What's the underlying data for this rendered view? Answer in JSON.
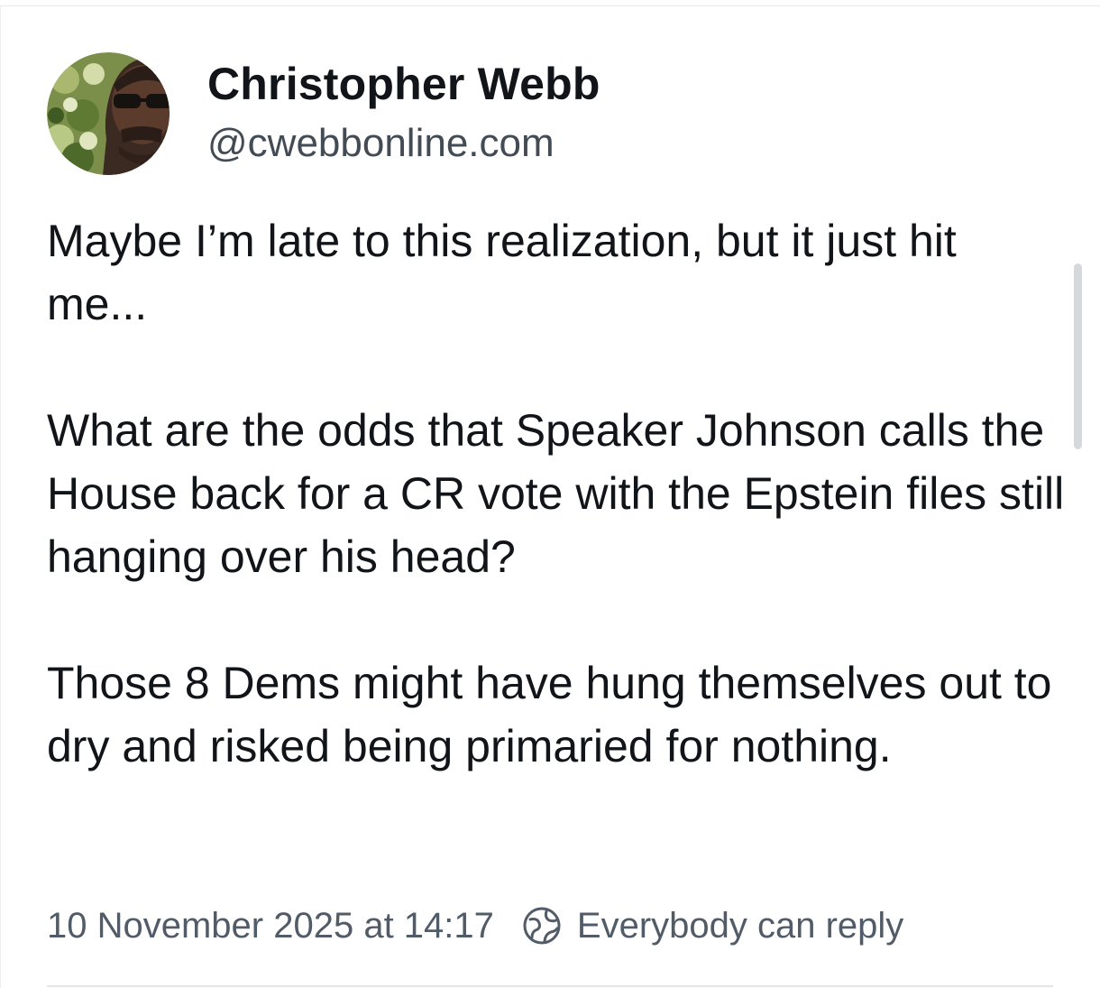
{
  "author": {
    "display_name": "Christopher Webb",
    "handle": "@cwebbonline.com",
    "avatar_icon": "profile-photo"
  },
  "post": {
    "paragraphs": [
      "Maybe I’m late to this realization, but it just hit me...",
      "What are the odds that Speaker Johnson calls the House back for a CR vote with the Epstein files still hanging over his head?",
      "Those 8 Dems might have hung themselves out to dry and risked being primaried for nothing."
    ],
    "timestamp": "10 November 2025 at 14:17",
    "reply_setting_icon": "globe-icon",
    "reply_setting": "Everybody can reply"
  },
  "colors": {
    "text_primary": "#111418",
    "text_secondary": "#525c68",
    "divider": "#e3e6e9"
  }
}
